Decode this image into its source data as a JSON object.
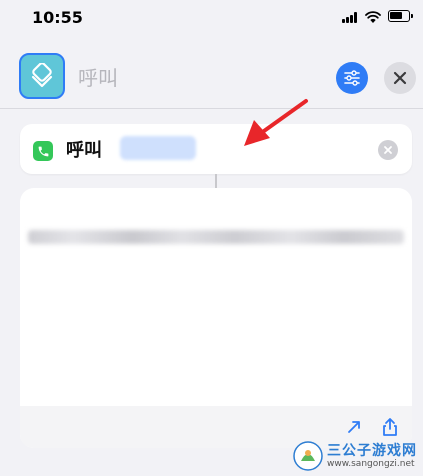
{
  "status_bar": {
    "time": "10:55"
  },
  "header": {
    "shortcut_name": "呼叫"
  },
  "action": {
    "label": "呼叫",
    "token_text": ""
  },
  "colors": {
    "accent": "#2f7cf6",
    "phone_green": "#34c759",
    "arrow_red": "#e8262a"
  },
  "watermark": {
    "title": "三公子游戏网",
    "url": "www.sangongzi.net"
  }
}
